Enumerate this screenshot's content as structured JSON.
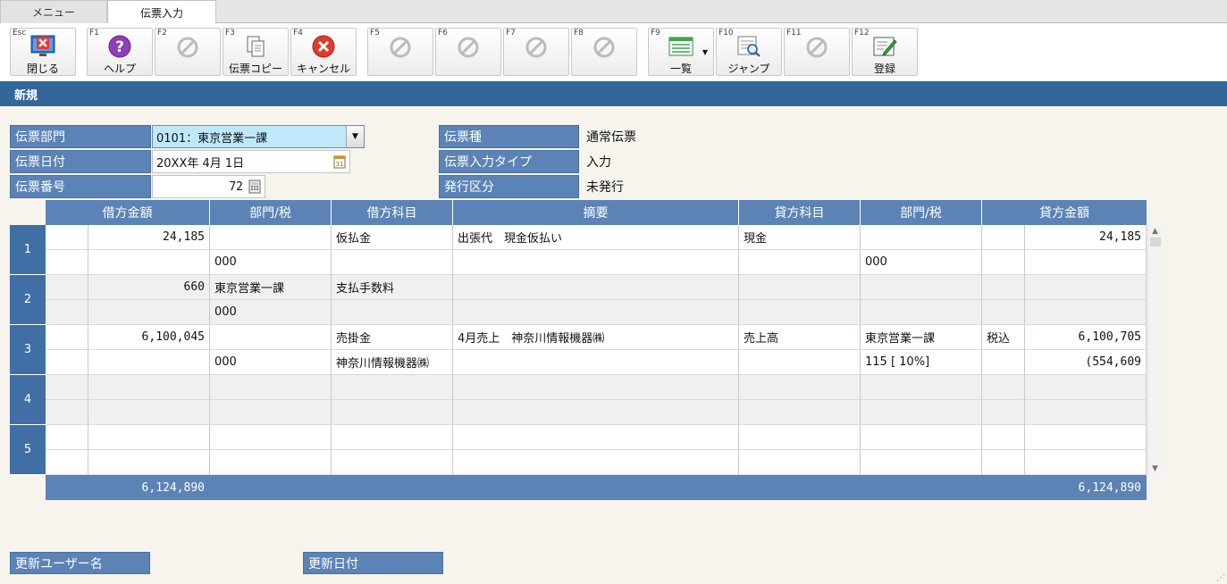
{
  "tabs": [
    {
      "label": "メニュー"
    },
    {
      "label": "伝票入力"
    }
  ],
  "toolbar": {
    "buttons": [
      {
        "key": "Esc",
        "label": "閉じる",
        "icon": "close-window-icon"
      },
      {
        "key": "F1",
        "label": "ヘルプ",
        "icon": "help-icon"
      },
      {
        "key": "F2",
        "label": "",
        "icon": "disabled-icon"
      },
      {
        "key": "F3",
        "label": "伝票コピー",
        "icon": "copy-icon"
      },
      {
        "key": "F4",
        "label": "キャンセル",
        "icon": "cancel-icon"
      },
      {
        "key": "F5",
        "label": "",
        "icon": "disabled-icon"
      },
      {
        "key": "F6",
        "label": "",
        "icon": "disabled-icon"
      },
      {
        "key": "F7",
        "label": "",
        "icon": "disabled-icon"
      },
      {
        "key": "F8",
        "label": "",
        "icon": "disabled-icon"
      },
      {
        "key": "F9",
        "label": "一覧",
        "icon": "list-icon"
      },
      {
        "key": "F10",
        "label": "ジャンプ",
        "icon": "jump-icon"
      },
      {
        "key": "F11",
        "label": "",
        "icon": "disabled-icon"
      },
      {
        "key": "F12",
        "label": "登録",
        "icon": "register-icon"
      }
    ]
  },
  "mode": "新規",
  "header": {
    "dept_label": "伝票部門",
    "dept_value": "0101：東京営業一課",
    "date_label": "伝票日付",
    "date_value": "20XX年  4月  1日",
    "number_label": "伝票番号",
    "number_value": "72",
    "type_label": "伝票種",
    "type_value": "通常伝票",
    "input_type_label": "伝票入力タイプ",
    "input_type_value": "入力",
    "issue_label": "発行区分",
    "issue_value": "未発行"
  },
  "grid": {
    "columns": [
      "借方金額",
      "部門/税",
      "借方科目",
      "摘要",
      "貸方科目",
      "部門/税",
      "貸方金額"
    ],
    "rows": [
      {
        "no": "1",
        "line1": {
          "dr_amt": "24,185",
          "dr_dept": "",
          "dr_acct": "仮払金",
          "memo": "出張代　現金仮払い",
          "cr_acct": "現金",
          "cr_dept": "",
          "cr_tax": "",
          "cr_amt": "24,185"
        },
        "line2": {
          "dr_amt": "",
          "dr_dept": "000",
          "dr_acct": "",
          "memo": "",
          "cr_acct": "",
          "cr_dept": "000",
          "cr_tax": "",
          "cr_amt": ""
        }
      },
      {
        "no": "2",
        "line1": {
          "dr_amt": "660",
          "dr_dept": "東京営業一課",
          "dr_acct": "支払手数料",
          "memo": "",
          "cr_acct": "",
          "cr_dept": "",
          "cr_tax": "",
          "cr_amt": ""
        },
        "line2": {
          "dr_amt": "",
          "dr_dept": "000",
          "dr_acct": "",
          "memo": "",
          "cr_acct": "",
          "cr_dept": "",
          "cr_tax": "",
          "cr_amt": ""
        }
      },
      {
        "no": "3",
        "line1": {
          "dr_amt": "6,100,045",
          "dr_dept": "",
          "dr_acct": "売掛金",
          "memo": "4月売上　神奈川情報機器㈱",
          "cr_acct": "売上高",
          "cr_dept": "東京営業一課",
          "cr_tax": "税込",
          "cr_amt": "6,100,705"
        },
        "line2": {
          "dr_amt": "",
          "dr_dept": "000",
          "dr_acct": "神奈川情報機器㈱",
          "memo": "",
          "cr_acct": "",
          "cr_dept": "115 [ 10%]",
          "cr_tax": "",
          "cr_amt": "(554,609"
        }
      },
      {
        "no": "4",
        "line1": {
          "dr_amt": "",
          "dr_dept": "",
          "dr_acct": "",
          "memo": "",
          "cr_acct": "",
          "cr_dept": "",
          "cr_tax": "",
          "cr_amt": ""
        },
        "line2": {
          "dr_amt": "",
          "dr_dept": "",
          "dr_acct": "",
          "memo": "",
          "cr_acct": "",
          "cr_dept": "",
          "cr_tax": "",
          "cr_amt": ""
        }
      },
      {
        "no": "5",
        "line1": {
          "dr_amt": "",
          "dr_dept": "",
          "dr_acct": "",
          "memo": "",
          "cr_acct": "",
          "cr_dept": "",
          "cr_tax": "",
          "cr_amt": ""
        },
        "line2": {
          "dr_amt": "",
          "dr_dept": "",
          "dr_acct": "",
          "memo": "",
          "cr_acct": "",
          "cr_dept": "",
          "cr_tax": "",
          "cr_amt": ""
        }
      }
    ],
    "total_debit": "6,124,890",
    "total_credit": "6,124,890"
  },
  "footer": {
    "update_user_label": "更新ユーザー名",
    "update_date_label": "更新日付"
  },
  "colors": {
    "header_blue": "#5b83b6",
    "mode_bar": "#336699",
    "selected_field": "#bfe9fb"
  }
}
